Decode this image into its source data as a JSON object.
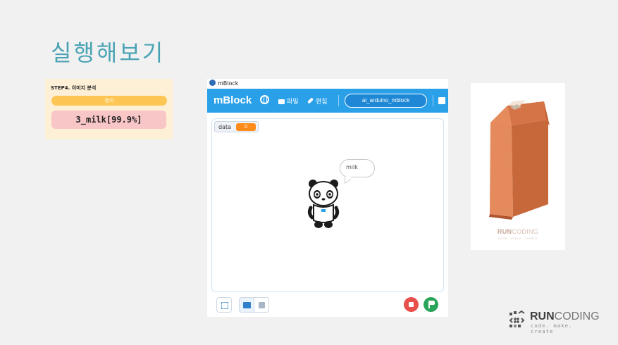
{
  "slide": {
    "title": "실행해보기"
  },
  "step_panel": {
    "step_label": "STEP4. 이미지 분석",
    "stop_button_label": "정지",
    "result_text": "3_milk[99.9%]",
    "accent_color": "#fdc654",
    "result_bg_color": "#f9c6c7"
  },
  "mblock": {
    "window_title": "mBlock",
    "brand": "mBlock",
    "menu": {
      "file_label": "파일",
      "edit_label": "편집"
    },
    "project_name": "ai_arduino_mblock",
    "accent_color": "#2aa0e8",
    "stage": {
      "variable": {
        "name": "data",
        "value": "0"
      },
      "speech_bubble": "milk",
      "sprite": "panda"
    },
    "controls": {
      "stop_icon": "stop-icon",
      "green_flag_icon": "green-flag-icon"
    }
  },
  "milk_card": {
    "object": "milk-carton",
    "logo_run": "RUN",
    "logo_coding": "CODING",
    "tagline": "code. make. create"
  },
  "footer": {
    "logo_run": "RUN",
    "logo_coding": "CODING",
    "tagline": "code. make. create"
  }
}
